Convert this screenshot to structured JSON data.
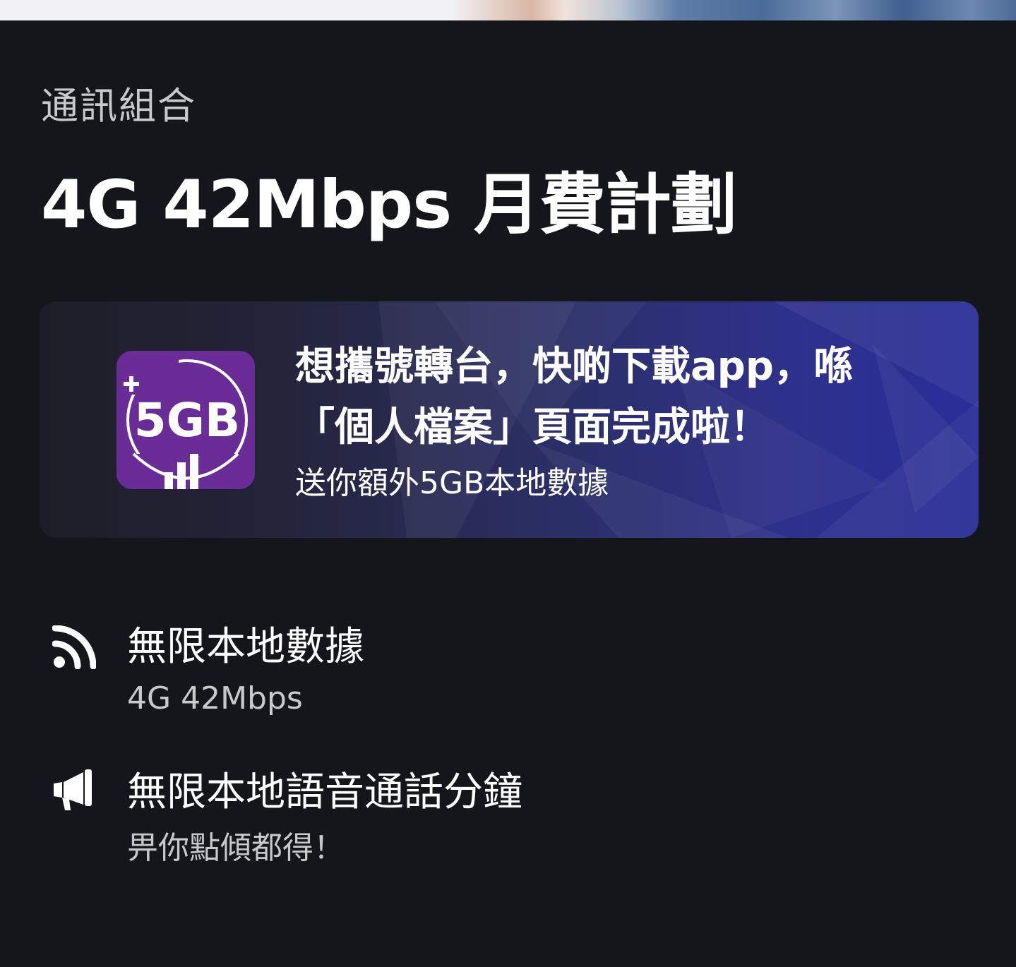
{
  "header": {
    "category": "通訊組合",
    "plan_title": "4G 42Mbps 月費計劃"
  },
  "promo": {
    "badge_text": "5GB",
    "badge_plus": "+",
    "headline": "想攜號轉台，快啲下載app，喺「個人檔案」頁面完成啦！",
    "subtext": "送你額外5GB本地數據"
  },
  "features": [
    {
      "icon": "rss-feed-icon",
      "title": "無限本地數據",
      "description": "4G 42Mbps"
    },
    {
      "icon": "megaphone-icon",
      "title": "無限本地語音通話分鐘",
      "description": "畀你點傾都得！"
    }
  ],
  "colors": {
    "background": "#15161b",
    "badge_purple": "#6a2c96",
    "banner_blue": "#2e318c",
    "secondary_text": "#c9c9cc"
  }
}
